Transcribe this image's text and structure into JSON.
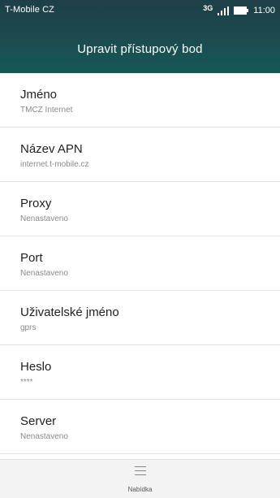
{
  "status_bar": {
    "carrier": "T-Mobile CZ",
    "network": "3G",
    "time": "11:00",
    "icons": [
      "signal-icon",
      "battery-icon"
    ]
  },
  "header": {
    "title": "Upravit přístupový bod"
  },
  "settings": [
    {
      "label": "Jméno",
      "value": "TMCZ Internet"
    },
    {
      "label": "Název APN",
      "value": "internet.t-mobile.cz"
    },
    {
      "label": "Proxy",
      "value": "Nenastaveno"
    },
    {
      "label": "Port",
      "value": "Nenastaveno"
    },
    {
      "label": "Uživatelské jméno",
      "value": "gprs"
    },
    {
      "label": "Heslo",
      "value": "****"
    },
    {
      "label": "Server",
      "value": "Nenastaveno"
    }
  ],
  "bottom_bar": {
    "menu_label": "Nabídka",
    "icon": "menu-icon"
  },
  "colors": {
    "header": "#1c4b50",
    "background": "#ffffff",
    "bottom_bar": "#f3f3f3"
  }
}
